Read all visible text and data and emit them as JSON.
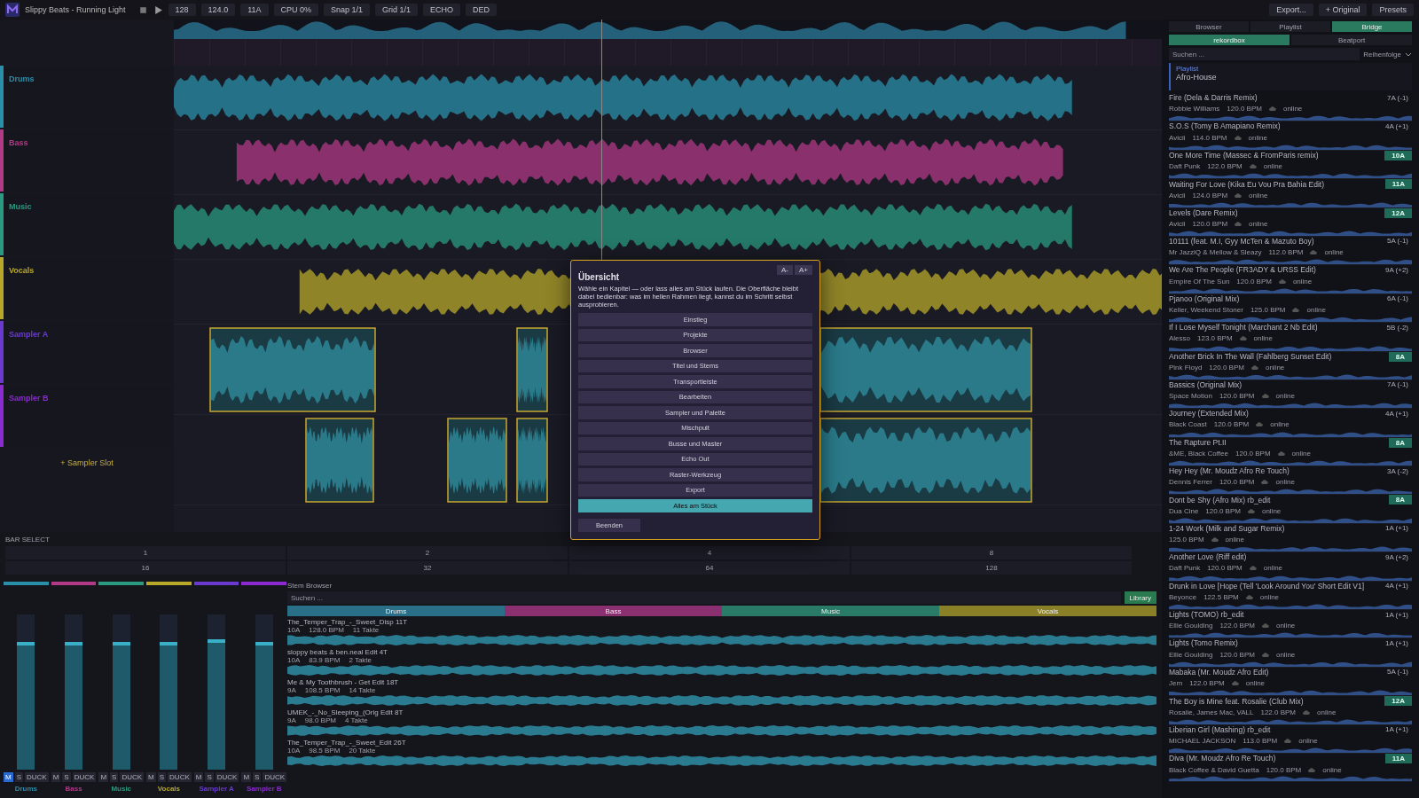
{
  "toolbar": {
    "title": "Slippy Beats - Running Light",
    "fields": [
      "128",
      "124.0",
      "11A",
      "CPU 0%",
      "Snap 1/1",
      "Grid 1/1"
    ],
    "buttons": [
      "ECHO",
      "DED"
    ],
    "right_buttons": [
      "Export...",
      "+ Original",
      "Presets"
    ]
  },
  "tracks": [
    {
      "name": "Drums",
      "color": "#2a8fa8",
      "kind": "audio"
    },
    {
      "name": "Bass",
      "color": "#b03a86",
      "kind": "audio"
    },
    {
      "name": "Music",
      "color": "#2a9a80",
      "kind": "audio"
    },
    {
      "name": "Vocals",
      "color": "#b8a82a",
      "kind": "audio"
    },
    {
      "name": "Sampler A",
      "color": "#6a3ad0",
      "kind": "sampler"
    },
    {
      "name": "Sampler B",
      "color": "#8a2ad0",
      "kind": "sampler"
    }
  ],
  "add_slot": "+ Sampler Slot",
  "bar_select": {
    "label": "BAR SELECT",
    "values": [
      "1",
      "2",
      "4",
      "8",
      "16",
      "32",
      "64",
      "128"
    ]
  },
  "mixer": [
    {
      "name": "Drums",
      "color": "#2a8fa8",
      "level": 0.8,
      "muted": true,
      "buttons": [
        "M",
        "S",
        "DUCK"
      ]
    },
    {
      "name": "Bass",
      "color": "#b03a86",
      "level": 0.8,
      "muted": false,
      "buttons": [
        "M",
        "S",
        "DUCK"
      ]
    },
    {
      "name": "Music",
      "color": "#2a9a80",
      "level": 0.8,
      "muted": false,
      "buttons": [
        "M",
        "S",
        "DUCK"
      ]
    },
    {
      "name": "Vocals",
      "color": "#b8a82a",
      "level": 0.8,
      "muted": false,
      "buttons": [
        "M",
        "S",
        "DUCK"
      ]
    },
    {
      "name": "Sampler A",
      "color": "#6a3ad0",
      "level": 0.82,
      "muted": false,
      "buttons": [
        "M",
        "S",
        "DUCK"
      ]
    },
    {
      "name": "Sampler B",
      "color": "#8a2ad0",
      "level": 0.8,
      "muted": false,
      "buttons": [
        "M",
        "S",
        "DUCK"
      ]
    }
  ],
  "stem_browser": {
    "title": "Stem Browser",
    "placeholder": "Suchen ...",
    "library_button": "Library",
    "tabs": [
      {
        "label": "Drums",
        "color": "#2a6f88"
      },
      {
        "label": "Bass",
        "color": "#8a2f70"
      },
      {
        "label": "Music",
        "color": "#2a7a68"
      },
      {
        "label": "Vocals",
        "color": "#8a8028"
      }
    ],
    "rows": [
      {
        "title": "The_Temper_Trap_-_Sweet_Disp 11T",
        "key": "10A",
        "bpm": "128.0 BPM",
        "bars": "11 Takte"
      },
      {
        "title": "sloppy beats & ben.neal Edit 4T",
        "key": "10A",
        "bpm": "83.9 BPM",
        "bars": "2 Takte"
      },
      {
        "title": "Me & My Toothbrush - Get Edit 18T",
        "key": "9A",
        "bpm": "108.5 BPM",
        "bars": "14 Takte"
      },
      {
        "title": "UMEK_-_No_Sleeping_(Orig Edit 8T",
        "key": "9A",
        "bpm": "98.0 BPM",
        "bars": "4 Takte"
      },
      {
        "title": "The_Temper_Trap_-_Sweet_Edit 26T",
        "key": "10A",
        "bpm": "98.5 BPM",
        "bars": "20 Takte"
      }
    ]
  },
  "browser": {
    "tabs": [
      {
        "label": "Browser",
        "selected": false
      },
      {
        "label": "Playlist",
        "selected": false
      },
      {
        "label": "Bridge",
        "selected": true
      }
    ],
    "subtabs": [
      {
        "label": "rekordbox",
        "selected": true
      },
      {
        "label": "Beatport",
        "selected": false
      }
    ],
    "placeholder": "Suchen ...",
    "sort": "Reihenfolge",
    "playlist_label": "Playlist",
    "playlist": "Afro-House",
    "tracks": [
      {
        "title": "Fire (Dela & Darris Remix)",
        "artist": "Robbie Williams",
        "bpm": "120.0 BPM",
        "status": "online",
        "key": "7A (-1)",
        "match": false
      },
      {
        "title": "S.O.S (Tomy B Amapiano Remix)",
        "artist": "Avicii",
        "bpm": "114.0 BPM",
        "status": "online",
        "key": "4A (+1)",
        "match": false
      },
      {
        "title": "One More Time (Massec & FromParis remix)",
        "artist": "Daft Punk",
        "bpm": "122.0 BPM",
        "status": "online",
        "key": "10A",
        "match": true
      },
      {
        "title": "Waiting For Love (Kika Eu Vou Pra Bahia Edit)",
        "artist": "Avicii",
        "bpm": "124.0 BPM",
        "status": "online",
        "key": "11A",
        "match": true
      },
      {
        "title": "Levels (Dare Remix)",
        "artist": "Avicii",
        "bpm": "120.0 BPM",
        "status": "online",
        "key": "12A",
        "match": true
      },
      {
        "title": "10111 (feat. M.I, Gyy McTen & Mazuto Boy)",
        "artist": "Mr JazziQ & Mellow & Sleazy",
        "bpm": "112.0 BPM",
        "status": "online",
        "key": "5A (-1)",
        "match": false
      },
      {
        "title": "We Are The People (FR3ADY & URSS Edit)",
        "artist": "Empire Of The Sun",
        "bpm": "120.0 BPM",
        "status": "online",
        "key": "9A (+2)",
        "match": false
      },
      {
        "title": "Pjanoo (Original Mix)",
        "artist": "Keller, Weekend Stoner",
        "bpm": "125.0 BPM",
        "status": "online",
        "key": "6A (-1)",
        "match": false
      },
      {
        "title": "If I Lose Myself Tonight (Marchant 2 Nb Edit)",
        "artist": "Alesso",
        "bpm": "123.0 BPM",
        "status": "online",
        "key": "5B (-2)",
        "match": false
      },
      {
        "title": "Another Brick In The Wall (Fahlberg Sunset Edit)",
        "artist": "Pink Floyd",
        "bpm": "120.0 BPM",
        "status": "online",
        "key": "8A",
        "match": true
      },
      {
        "title": "Bassics (Original Mix)",
        "artist": "Space Motion",
        "bpm": "120.0 BPM",
        "status": "online",
        "key": "7A (-1)",
        "match": false
      },
      {
        "title": "Journey (Extended Mix)",
        "artist": "Black Coast",
        "bpm": "120.0 BPM",
        "status": "online",
        "key": "4A (+1)",
        "match": false
      },
      {
        "title": "The Rapture Pt.II",
        "artist": "&ME, Black Coffee",
        "bpm": "120.0 BPM",
        "status": "online",
        "key": "8A",
        "match": true
      },
      {
        "title": "Hey Hey (Mr. Moudz Afro Re Touch)",
        "artist": "Dennis Ferrer",
        "bpm": "120.0 BPM",
        "status": "online",
        "key": "3A (-2)",
        "match": false
      },
      {
        "title": "Dont be Shy (Afro Mix) rb_edit",
        "artist": "Dua Cine",
        "bpm": "120.0 BPM",
        "status": "online",
        "key": "8A",
        "match": true
      },
      {
        "title": "1-24 Work (Milk and Sugar Remix)",
        "bpm": "125.0 BPM",
        "status": "online",
        "key": "1A (+1)",
        "match": false
      },
      {
        "title": "Another Love (Riff edit)",
        "artist": "Daft Punk",
        "bpm": "120.0 BPM",
        "status": "online",
        "key": "9A (+2)",
        "match": false
      },
      {
        "title": "Drunk in Love [Hope (Tell 'Look Around You' Short Edit V1]",
        "artist": "Beyonce",
        "bpm": "122.5 BPM",
        "status": "online",
        "key": "4A (+1)",
        "match": false
      },
      {
        "title": "Lights (TOMO) rb_edit",
        "artist": "Ellie Goulding",
        "bpm": "122.0 BPM",
        "status": "online",
        "key": "1A (+1)",
        "match": false
      },
      {
        "title": "Lights (Tomo Remix)",
        "artist": "Ellie Goulding",
        "bpm": "120.0 BPM",
        "status": "online",
        "key": "1A (+1)",
        "match": false
      },
      {
        "title": "Mabaka (Mr. Moudz Afro Edit)",
        "artist": "Jem",
        "bpm": "122.0 BPM",
        "status": "online",
        "key": "5A (-1)",
        "match": false
      },
      {
        "title": "The Boy is Mine feat. Rosalie (Club Mix)",
        "artist": "Rosalie, James Mac, VALL",
        "bpm": "122.0 BPM",
        "status": "online",
        "key": "12A",
        "match": true
      },
      {
        "title": "Liberian Girl (Mashing) rb_edit",
        "artist": "MICHAEL JACKSON",
        "bpm": "113.0 BPM",
        "status": "online",
        "key": "1A (+1)",
        "match": false
      },
      {
        "title": "Diva (Mr. Moudz Afro Re Touch)",
        "artist": "Black Coffee & David Guetta",
        "bpm": "120.0 BPM",
        "status": "online",
        "key": "11A",
        "match": true
      }
    ]
  },
  "dialog": {
    "title": "Übersicht",
    "font_buttons": [
      "A-",
      "A+"
    ],
    "text": "Wähle ein Kapitel — oder lass alles am Stück laufen. Die Oberfläche bleibt dabei bedienbar: was im hellen Rahmen liegt, kannst du im Schritt selbst ausprobieren.",
    "chapters": [
      {
        "label": "Einstieg",
        "selected": false
      },
      {
        "label": "Projekte",
        "selected": false
      },
      {
        "label": "Browser",
        "selected": false
      },
      {
        "label": "Titel und Stems",
        "selected": false
      },
      {
        "label": "Transportleiste",
        "selected": false
      },
      {
        "label": "Bearbeiten",
        "selected": false
      },
      {
        "label": "Sampler und Palette",
        "selected": false
      },
      {
        "label": "Mischpult",
        "selected": false
      },
      {
        "label": "Busse und Master",
        "selected": false
      },
      {
        "label": "Echo Out",
        "selected": false
      },
      {
        "label": "Raster-Werkzeug",
        "selected": false
      },
      {
        "label": "Export",
        "selected": false
      },
      {
        "label": "Alles am Stück",
        "selected": true
      }
    ],
    "close_button": "Beenden"
  }
}
